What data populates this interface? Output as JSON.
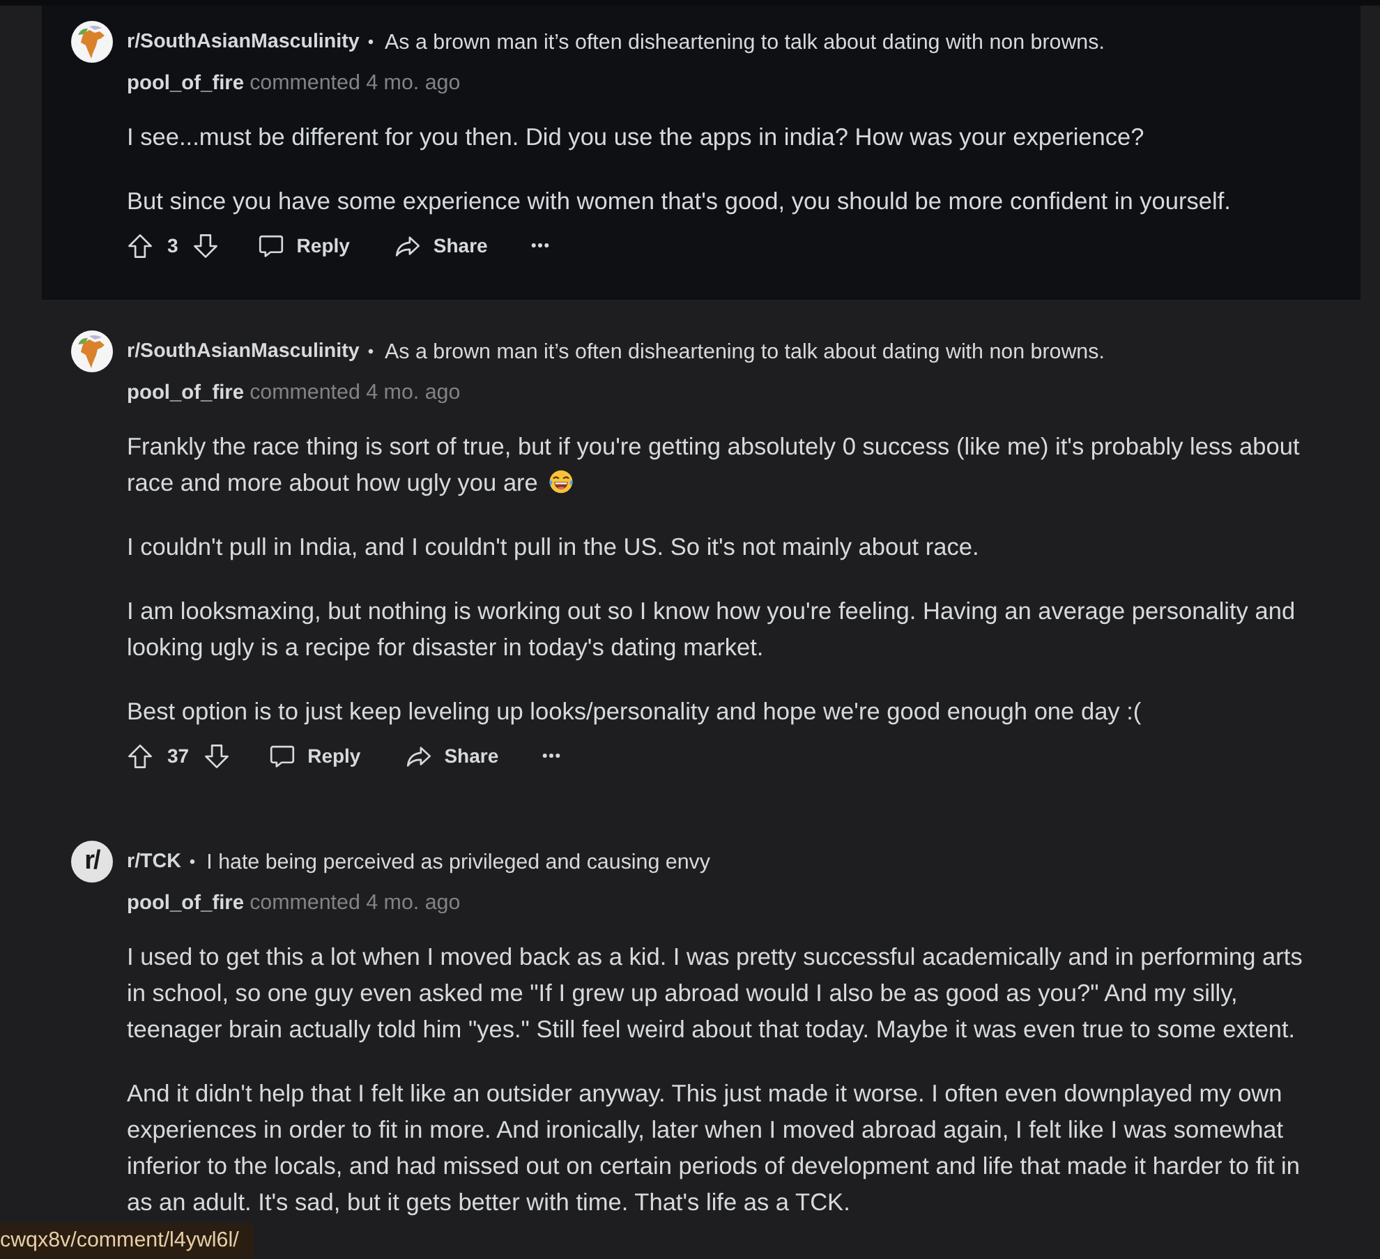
{
  "comments": [
    {
      "highlighted": true,
      "avatar": {
        "kind": "map"
      },
      "subreddit": "r/SouthAsianMasculinity",
      "separator": "•",
      "post_title": "As a brown man it’s often disheartening to talk about dating with non browns.",
      "author": "pool_of_fire",
      "meta": "commented 4 mo. ago",
      "paragraphs": [
        {
          "text": "I see...must be different for you then. Did you use the apps in india? How was your experience?",
          "emoji": false
        },
        {
          "text": "But since you have some experience with women that's good, you should be more confident in yourself.",
          "emoji": false
        }
      ],
      "score": "3",
      "actions": [
        {
          "kind": "reply",
          "label": "Reply"
        },
        {
          "kind": "share",
          "label": "Share"
        },
        {
          "kind": "more"
        }
      ]
    },
    {
      "highlighted": false,
      "avatar": {
        "kind": "map"
      },
      "subreddit": "r/SouthAsianMasculinity",
      "separator": "•",
      "post_title": "As a brown man it’s often disheartening to talk about dating with non browns.",
      "author": "pool_of_fire",
      "meta": "commented 4 mo. ago",
      "paragraphs": [
        {
          "text": "Frankly the race thing is sort of true, but if you're getting absolutely 0 success (like me) it's probably less about race and more about how ugly you are",
          "emoji": true
        },
        {
          "text": "I couldn't pull in India, and I couldn't pull in the US. So it's not mainly about race.",
          "emoji": false
        },
        {
          "text": "I am looksmaxing, but nothing is working out so I know how you're feeling. Having an average personality and looking ugly is a recipe for disaster in today's dating market.",
          "emoji": false
        },
        {
          "text": "Best option is to just keep leveling up looks/personality and hope we're good enough one day :(",
          "emoji": false
        }
      ],
      "score": "37",
      "actions": [
        {
          "kind": "reply",
          "label": "Reply"
        },
        {
          "kind": "share",
          "label": "Share"
        },
        {
          "kind": "more"
        }
      ]
    },
    {
      "highlighted": false,
      "avatar": {
        "kind": "letters",
        "text": "r/"
      },
      "subreddit": "r/TCK",
      "separator": "•",
      "post_title": "I hate being perceived as privileged and causing envy",
      "author": "pool_of_fire",
      "meta": "commented 4 mo. ago",
      "paragraphs": [
        {
          "text": "I used to get this a lot when I moved back as a kid. I was pretty successful academically and in performing arts in school, so one guy even asked me \"If I grew up abroad would I also be as good as you?\" And my silly, teenager brain actually told him \"yes.\" Still feel weird about that today. Maybe it was even true to some extent.",
          "emoji": false
        },
        {
          "text": "And it didn't help that I felt like an outsider anyway. This just made it worse. I often even downplayed my own experiences in order to fit in more. And ironically, later when I moved abroad again, I felt like I was somewhat inferior to the locals, and had missed out on certain periods of development and life that made it harder to fit in as an adult. It's sad, but it gets better with time. That's life as a TCK.",
          "emoji": false
        }
      ]
    }
  ],
  "status_url": "cwqx8v/comment/l4ywl6l/"
}
